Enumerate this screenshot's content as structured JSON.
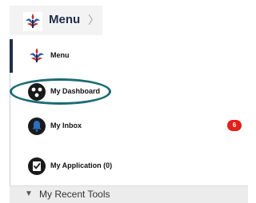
{
  "header": {
    "menu_label": "Menu",
    "logo_icon": "bsa-fleur-de-lis-icon",
    "chevron_icon": "chevron-right-icon"
  },
  "menu": {
    "items": [
      {
        "label": "Menu",
        "icon": "bsa-fleur-de-lis-icon",
        "active": true
      },
      {
        "label": "My Dashboard",
        "icon": "dashboard-icon",
        "highlighted": true
      },
      {
        "label": "My Inbox",
        "icon": "bell-icon",
        "badge": "6"
      },
      {
        "label": "My Application (0)",
        "icon": "checklist-icon"
      }
    ]
  },
  "recent_tools": {
    "label": "My Recent Tools",
    "expanded": true
  },
  "colors": {
    "brand_navy": "#1f2f4a",
    "badge_red": "#e3201b",
    "highlight_ring": "#1b6b74"
  }
}
